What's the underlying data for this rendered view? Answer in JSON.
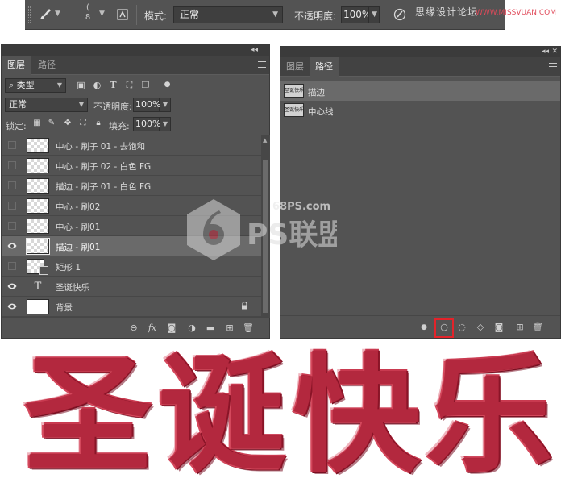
{
  "options_bar": {
    "brush_size": "8",
    "mode_label": "模式:",
    "mode_value": "正常",
    "opacity_label": "不透明度:",
    "opacity_value": "100%"
  },
  "watermark": {
    "top_text": "思缘设计论坛",
    "top_url": "WWW.MISSVUAN.COM",
    "center_url": "68PS.com",
    "center_text": "PS联盟"
  },
  "layers_panel": {
    "tabs": [
      {
        "label": "图层",
        "active": true
      },
      {
        "label": "路径",
        "active": false
      }
    ],
    "filter_kind": "类型",
    "blend_mode": "正常",
    "opacity_label": "不透明度:",
    "opacity_value": "100%",
    "lock_label": "锁定:",
    "fill_label": "填充:",
    "fill_value": "100%",
    "layers": [
      {
        "name": "中心 - 刷子 01 - 去饱和",
        "visible": false,
        "thumb": "transparent",
        "selected": false
      },
      {
        "name": "中心 - 刷子 02 - 白色 FG",
        "visible": false,
        "thumb": "transparent",
        "selected": false
      },
      {
        "name": "描边 - 刷子 01 - 白色 FG",
        "visible": false,
        "thumb": "transparent",
        "selected": false
      },
      {
        "name": "中心 - 刷02",
        "visible": false,
        "thumb": "transparent",
        "selected": false
      },
      {
        "name": "中心 - 刷01",
        "visible": false,
        "thumb": "transparent",
        "selected": false
      },
      {
        "name": "描边 - 刷01",
        "visible": true,
        "thumb": "transparent",
        "selected": true
      },
      {
        "name": "矩形 1",
        "visible": false,
        "thumb": "shape",
        "selected": false
      },
      {
        "name": "圣诞快乐",
        "visible": true,
        "thumb": "text",
        "selected": false
      },
      {
        "name": "背景",
        "visible": true,
        "thumb": "white",
        "selected": false,
        "locked": true
      }
    ],
    "text_thumb_glyph": "T"
  },
  "paths_panel": {
    "tabs": [
      {
        "label": "图层",
        "active": false
      },
      {
        "label": "路径",
        "active": true
      }
    ],
    "paths": [
      {
        "name": "描边",
        "thumb_text": "圣诞快乐",
        "selected": true
      },
      {
        "name": "中心线",
        "thumb_text": "圣诞快乐",
        "selected": false
      }
    ],
    "highlighted_button": "stroke-path-with-brush-button",
    "highlight_color": "#e3232a"
  },
  "artwork": {
    "characters": [
      "圣",
      "诞",
      "快",
      "乐"
    ],
    "tinsel_color": "#b3283e"
  }
}
